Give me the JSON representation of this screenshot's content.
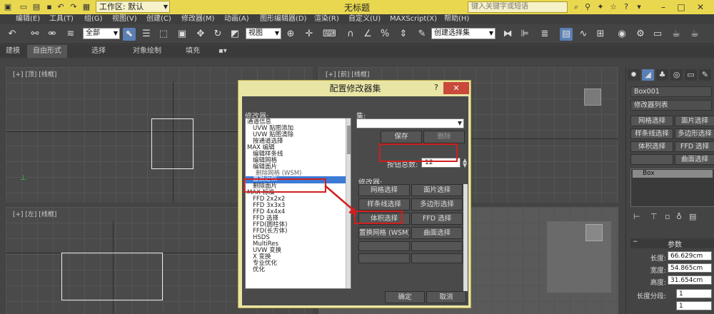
{
  "titlebar": {
    "workspace_label": "工作区: 默认",
    "title": "无标题",
    "search_placeholder": "键入关键字或短语"
  },
  "menu": [
    "编辑(E)",
    "工具(T)",
    "组(G)",
    "视图(V)",
    "创建(C)",
    "修改器(M)",
    "动画(A)",
    "图形编辑器(D)",
    "渲染(R)",
    "自定义(U)",
    "MAXScript(X)",
    "帮助(H)"
  ],
  "toolbar": {
    "selection_filter": "全部",
    "ref_coord": "视图",
    "named_selection": "创建选择集"
  },
  "ribbon": [
    "建模",
    "自由形式",
    "选择",
    "对象绘制",
    "填充"
  ],
  "viewports": {
    "top": "[+] [顶] [线框]",
    "front": "[+] [前] [线框]",
    "left": "[+] [左] [线框]"
  },
  "dialog": {
    "title": "配置修改器集",
    "help": "?",
    "modifiers_label": "修改器:",
    "modifiers_list": [
      "通道信息",
      "UVW 贴图添加",
      "UVW 贴图清除",
      "按通道选择",
      "MAX 编辑",
      "编辑样条线",
      "编辑网格",
      "编辑面片",
      "删除网格 (WSM)",
      "置换近似",
      "删除面片",
      "MAX 标准",
      "FFD 2x2x2",
      "FFD 3x3x3",
      "FFD 4x4x4",
      "FFD 选择",
      "FFD(圆柱体)",
      "FFD(长方体)",
      "HSDS",
      "MultiRes",
      "UVW 变换",
      "X 变换",
      "专业优化",
      "优化"
    ],
    "selected_index": 9,
    "sets_label": "集:",
    "save": "保存",
    "delete": "删除",
    "total_buttons_label": "按钮总数:",
    "total_buttons_value": "12",
    "modifiers_group_label": "修改器:",
    "slot_buttons": [
      "网格选择",
      "面片选择",
      "样条线选择",
      "多边形选择",
      "体积选择",
      "FFD 选择",
      "置换网格 (WSM)",
      "曲面选择",
      "",
      "",
      "",
      ""
    ],
    "ok": "确定",
    "cancel": "取消"
  },
  "command_panel": {
    "object_name": "Box001",
    "modifier_list": "修改器列表",
    "buttons": [
      "网格选择",
      "面片选择",
      "样条线选择",
      "多边形选择",
      "体积选择",
      "FFD 选择",
      "",
      "曲面选择"
    ],
    "stack_item": "Box",
    "rollout_title": "参数",
    "params": [
      {
        "label": "长度:",
        "value": "66.629cm"
      },
      {
        "label": "宽度:",
        "value": "54.865cm"
      },
      {
        "label": "高度:",
        "value": "31.654cm"
      }
    ],
    "segment_label": "长度分段:",
    "segment_value": "1",
    "segment_value2": "1"
  }
}
